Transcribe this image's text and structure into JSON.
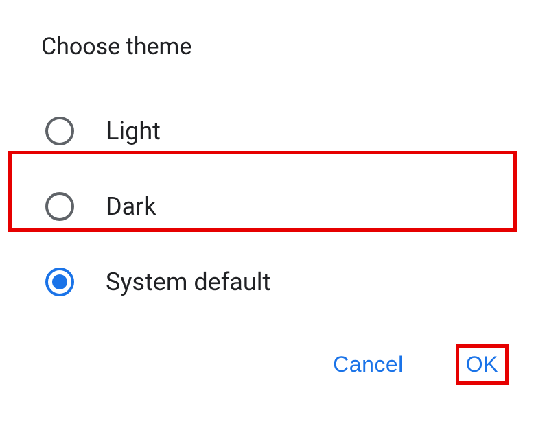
{
  "dialog": {
    "title": "Choose theme",
    "options": [
      {
        "label": "Light",
        "selected": false
      },
      {
        "label": "Dark",
        "selected": false
      },
      {
        "label": "System default",
        "selected": true
      }
    ],
    "actions": {
      "cancel_label": "Cancel",
      "ok_label": "OK"
    }
  }
}
